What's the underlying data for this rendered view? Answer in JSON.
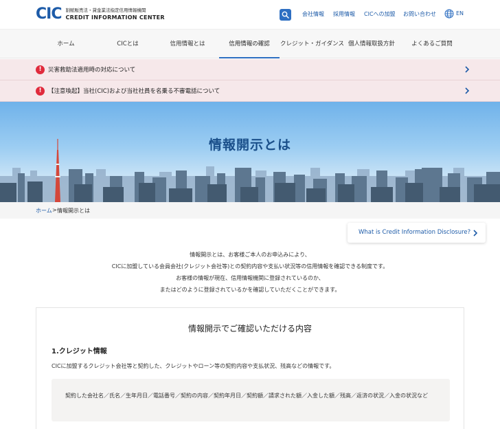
{
  "header": {
    "logo_mark": "CIC",
    "logo_sub": "割賦販売法・貸金業法指定信用情報機関",
    "logo_en": "CREDIT INFORMATION CENTER",
    "util_links": [
      "会社情報",
      "採用情報",
      "CICへの加盟",
      "お問い合わせ"
    ],
    "lang": "EN"
  },
  "nav": {
    "items": [
      "ホーム",
      "CICとは",
      "信用情報とは",
      "信用情報の確認",
      "クレジット・ガイダンス",
      "個人情報取扱方針",
      "よくあるご質問"
    ],
    "active": "信用情報の確認"
  },
  "notices": [
    "災害救助法適用時の対応について",
    "【注意喚起】当社(CIC)および当社社員を名乗る不審電話について"
  ],
  "hero": {
    "title": "情報開示とは"
  },
  "breadcrumb": {
    "home": "ホーム",
    "sep": ">",
    "current": "情報開示とは"
  },
  "en_link": "What is Credit Information Disclosure?",
  "intro": [
    "情報開示とは、お客様ご本人のお申込みにより、",
    "CICに加盟している会員会社(クレジット会社等)との契約内容や支払い状況等の信用情報を確認できる制度です。",
    "お客様の情報が現在、信用情報機関に登録されているのか、",
    "またはどのように登録されているかを確認していただくことができます。"
  ],
  "card": {
    "title": "情報開示でご確認いただける内容",
    "section1": {
      "title": "1.クレジット情報",
      "desc": "CICに加盟するクレジット会社等と契約した、クレジットやローン等の契約内容や支払状況、残高などの情報です。",
      "items": "契約した会社名／氏名／生年月日／電話番号／契約の内容／契約年月日／契約額／請求された額／入金した額／残高／返済の状況／入金の状況など"
    }
  },
  "colors": {
    "brand": "#1d5ba8",
    "notice_bg": "#f6e8ea",
    "warn": "#e02b3c"
  }
}
